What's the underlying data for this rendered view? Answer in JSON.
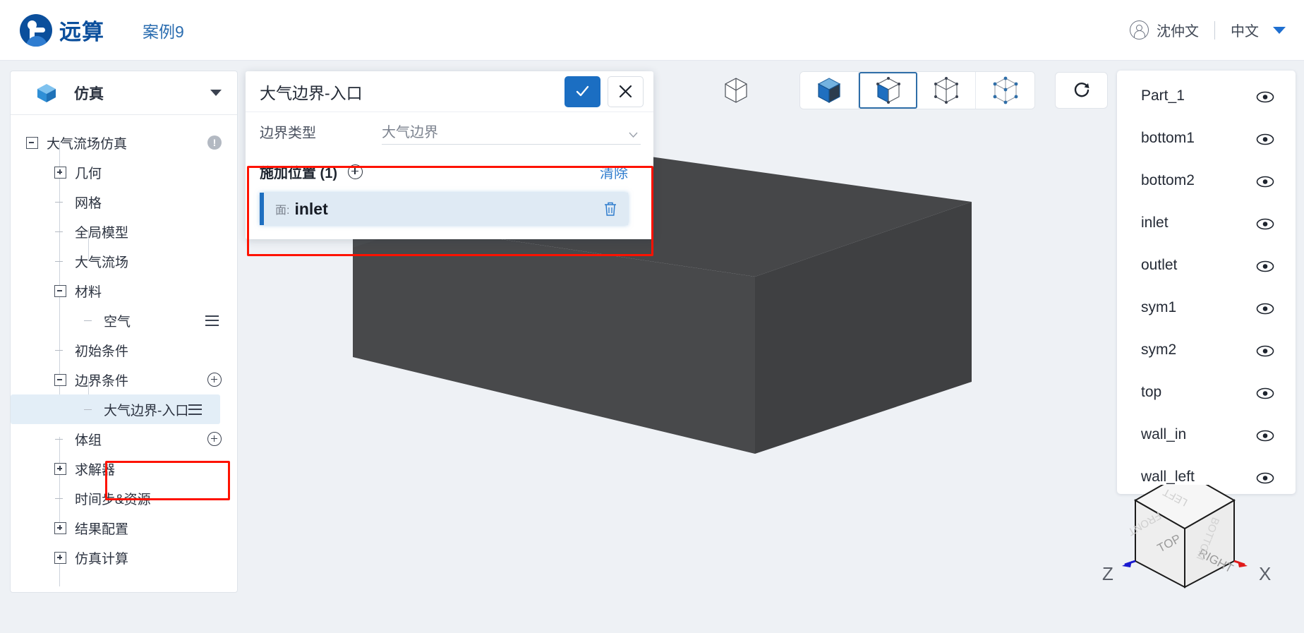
{
  "header": {
    "logo_text": "远算",
    "logo_icon": "brand-logo-icon",
    "case_name": "案例9",
    "user_icon": "user-circle-icon",
    "user_name": "沈仲文",
    "language": "中文",
    "caret_icon": "chevron-down-icon"
  },
  "sidebar": {
    "icon": "simulation-cube-icon",
    "title": "仿真",
    "collapse_icon": "chevron-down-icon",
    "tree": [
      {
        "label": "大气流场仿真",
        "toggle": "minus",
        "depth": 0,
        "badge": "!"
      },
      {
        "label": "几何",
        "toggle": "plus",
        "depth": 1
      },
      {
        "label": "网格",
        "toggle": "leaf",
        "depth": 1
      },
      {
        "label": "全局模型",
        "toggle": "leaf",
        "depth": 1
      },
      {
        "label": "大气流场",
        "toggle": "leaf",
        "depth": 1
      },
      {
        "label": "材料",
        "toggle": "minus",
        "depth": 1
      },
      {
        "label": "空气",
        "toggle": "corner",
        "depth": 2,
        "menu": true
      },
      {
        "label": "初始条件",
        "toggle": "leaf",
        "depth": 1
      },
      {
        "label": "边界条件",
        "toggle": "minus",
        "depth": 1,
        "plus": true
      },
      {
        "label": "大气边界-入口",
        "toggle": "leaf",
        "depth": 2,
        "menu": true,
        "selected": true,
        "highlight": true
      },
      {
        "label": "体组",
        "toggle": "leaf",
        "depth": 1,
        "plus": true
      },
      {
        "label": "求解器",
        "toggle": "plus",
        "depth": 1
      },
      {
        "label": "时间步&资源",
        "toggle": "leaf",
        "depth": 1
      },
      {
        "label": "结果配置",
        "toggle": "plus",
        "depth": 1
      },
      {
        "label": "仿真计算",
        "toggle": "plus",
        "depth": 1
      }
    ]
  },
  "dialog": {
    "title": "大气边界-入口",
    "confirm_icon": "check-icon",
    "cancel_icon": "close-icon",
    "field": {
      "label": "边界类型",
      "value": "大气边界",
      "caret_icon": "chevron-down-icon"
    },
    "location": {
      "title": "施加位置 (1)",
      "add_icon": "plus-circle-icon",
      "clear_label": "清除",
      "items": [
        {
          "type_label": "面:",
          "name": "inlet",
          "delete_icon": "trash-icon"
        }
      ]
    }
  },
  "toolbar": {
    "items": [
      {
        "name": "wireframe-cube-icon",
        "active": false,
        "standalone": true
      },
      {
        "name": "shaded-cube-icon",
        "active": false
      },
      {
        "name": "shaded-edges-cube-icon",
        "active": true
      },
      {
        "name": "hidden-line-cube-icon",
        "active": false
      },
      {
        "name": "points-cube-icon",
        "active": false
      },
      {
        "name": "reset-view-icon",
        "active": false,
        "standalone": true
      }
    ]
  },
  "parts_panel": {
    "visibility_icon": "eye-icon",
    "items": [
      {
        "label": "Part_1"
      },
      {
        "label": "bottom1"
      },
      {
        "label": "bottom2"
      },
      {
        "label": "inlet"
      },
      {
        "label": "outlet"
      },
      {
        "label": "sym1"
      },
      {
        "label": "sym2"
      },
      {
        "label": "top"
      },
      {
        "label": "wall_in"
      },
      {
        "label": "wall_left"
      }
    ]
  },
  "navcube": {
    "faces": [
      "TOP",
      "RIGHT",
      "FRONT",
      "LEFT",
      "BOTTOM"
    ],
    "axis_z": "Z",
    "axis_x": "X",
    "colors": {
      "z_axis": "#1a1ad0",
      "x_axis": "#e01b1b"
    }
  },
  "colors": {
    "brand": "#0b4f9c",
    "accent": "#1b6ec2",
    "highlight_box": "#fe1200",
    "selection": "#dfeaf4",
    "model": "#4a4d4f"
  }
}
